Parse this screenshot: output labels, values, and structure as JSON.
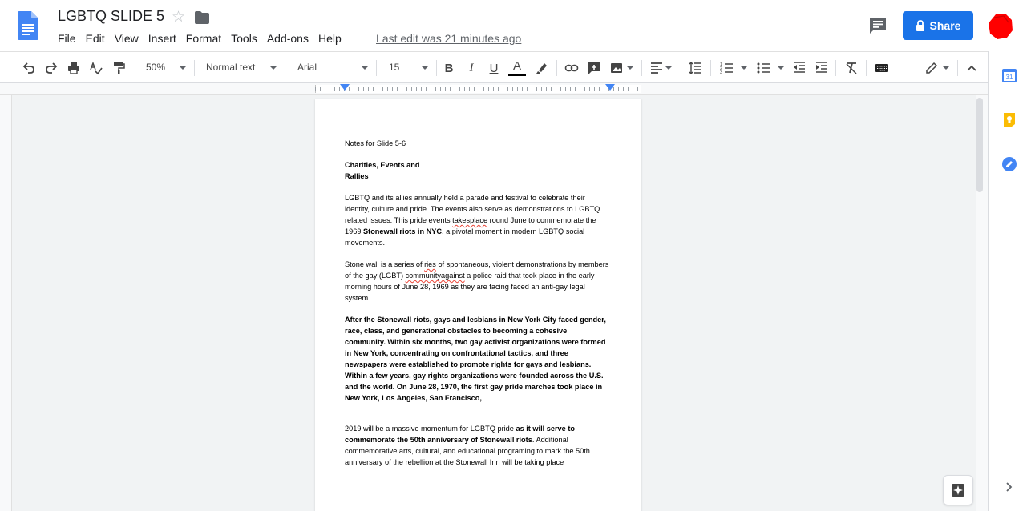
{
  "header": {
    "title": "LGBTQ SLIDE 5",
    "last_edit": "Last edit was 21 minutes ago",
    "share_label": "Share",
    "menu": [
      "File",
      "Edit",
      "View",
      "Insert",
      "Format",
      "Tools",
      "Add-ons",
      "Help"
    ]
  },
  "toolbar": {
    "zoom": "50%",
    "style": "Normal text",
    "font": "Arial",
    "font_size": "15"
  },
  "document": {
    "heading_note": "Notes for Slide 5-6",
    "section_title_line1": "Charities, Events and",
    "section_title_line2": "Rallies",
    "p1_a": "LGBTQ and its allies annually held a parade and festival to celebrate their identity, culture and pride. The events also serve as demonstrations to LGBTQ related issues. This pride events ",
    "p1_spell": "takesplace",
    "p1_b": " round June to commemorate the 1969 ",
    "p1_bold": "Stonewall riots in NYC",
    "p1_c": ", a pivotal moment in modern LGBTQ social movements.",
    "p2_a": "Stone wall is a series of ",
    "p2_spell1": "ries",
    "p2_b": " of spontaneous, violent demonstrations by members of the gay (LGBT) ",
    "p2_spell2": "communityagainst",
    "p2_c": " a police raid that took place in the early morning hours of June 28, 1969 as they are facing faced an anti-gay legal system.",
    "p3_bold": "After the Stonewall riots, gays and lesbians in New York City faced gender, race, class, and generational obstacles to becoming a cohesive community. Within six months, two gay activist organizations were formed in New York, concentrating on confrontational tactics, and three newspapers were established to promote rights for gays and lesbians. Within a few years, gay rights organizations were founded across the U.S. and the world. On June 28, 1970, the first gay pride marches took place in New York, Los Angeles, San Francisco,",
    "p4_a": "2019 will be a massive momentum for LGBTQ pride ",
    "p4_bold": "as it will serve to commemorate the 50th anniversary of Stonewall riots",
    "p4_b": ". Additional commemorative arts, cultural, and educational programing to mark the 50th anniversary of the rebellion at the Stonewall Inn will be taking place"
  },
  "colors": {
    "accent": "#1a73e8",
    "avatar": "#ff0000",
    "spell_underline": "#ea4335"
  },
  "side_panel": {
    "calendar_day": "31"
  }
}
